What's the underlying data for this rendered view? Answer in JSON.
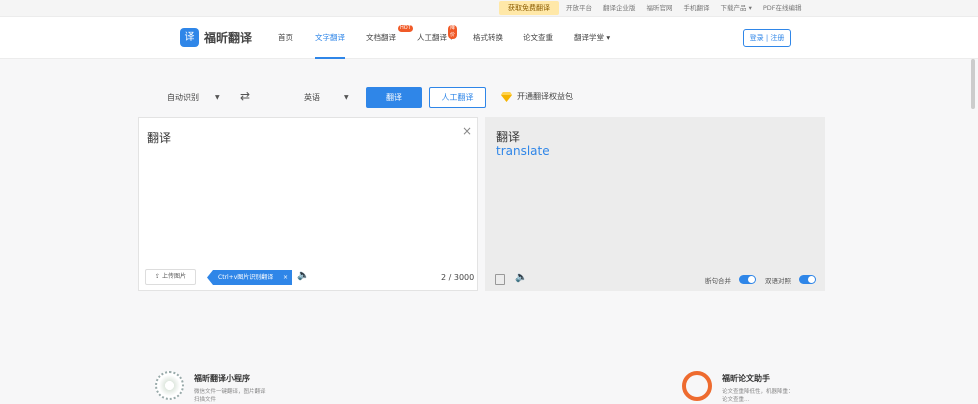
{
  "topbar": {
    "promo": "获取免费翻译",
    "links": [
      "开放平台",
      "翻译企业版",
      "福昕官网",
      "手机翻译",
      "下载产品 ▾",
      "PDF在线编辑"
    ]
  },
  "header": {
    "logo_icon": "译",
    "logo_text": "福昕翻译",
    "nav": {
      "home": "首页",
      "text_translate": "文字翻译",
      "doc_translate": "文档翻译",
      "human_translate": "人工翻译 ▾",
      "format_convert": "格式转换",
      "paper_check": "论文查重",
      "translate_learn": "翻译学堂 ▾"
    },
    "badges": {
      "doc": "HOT",
      "human": "降价"
    },
    "login": "登录 | 注册"
  },
  "toolbar": {
    "source_lang": "自动识别",
    "target_lang": "英语",
    "swap_icon": "⇄",
    "translate_label": "翻译",
    "human_label": "人工翻译",
    "vip_label": "开通翻译权益包"
  },
  "source_panel": {
    "text": "翻译",
    "clear_icon": "×",
    "upload_label": "上传图片",
    "ocr_tag": "Ctrl+v图片识别翻译",
    "ocr_close": "×",
    "counter": "2 / 3000"
  },
  "result_panel": {
    "source_echo": "翻译",
    "translation": "translate",
    "toggle_merge": "断句合并",
    "toggle_bilingual": "双语对照"
  },
  "footer": {
    "mini_title": "福昕翻译小程序",
    "mini_sub1": "微信文件一键翻译，图片翻译",
    "mini_sub2": "扫描文件",
    "paper_title": "福昕论文助手",
    "paper_sub1": "论文查重降低性，机器降重：",
    "paper_sub2": "论文查重…"
  },
  "colors": {
    "accent": "#2f86e8",
    "brand_orange": "#ee6b2f"
  }
}
